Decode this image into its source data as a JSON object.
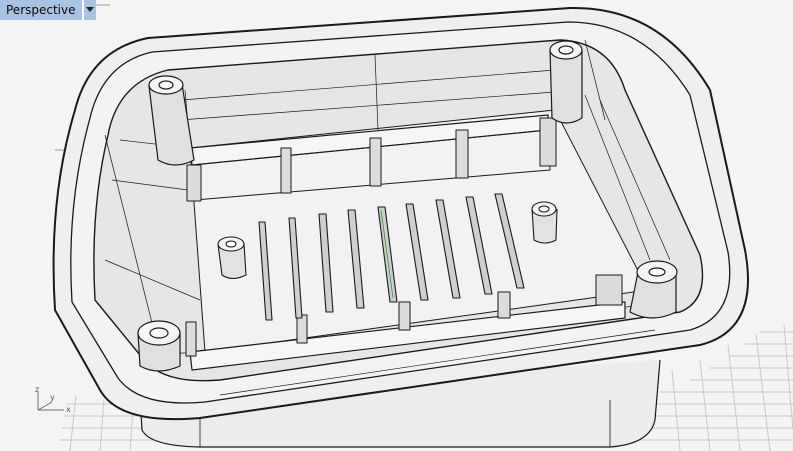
{
  "viewport": {
    "label": "Perspective",
    "dropdown_icon": "triangle-down-icon"
  },
  "axis_triad": {
    "z": "z",
    "y": "y",
    "x": "x"
  },
  "colors": {
    "tab_bg": "#aac3e3",
    "grid": "#c8c8c8",
    "background": "#f4f4f4",
    "model_fill": "#f0f0f0",
    "edge": "#1a1a1a"
  }
}
